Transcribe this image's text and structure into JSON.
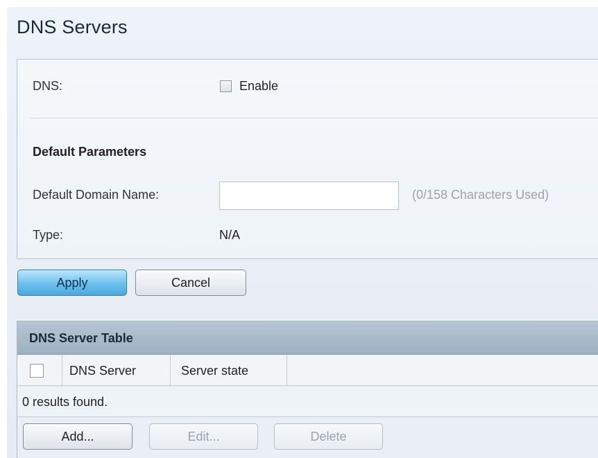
{
  "page": {
    "title": "DNS Servers"
  },
  "dns": {
    "label": "DNS:",
    "enable_label": "Enable",
    "enabled": false
  },
  "default_parameters": {
    "heading": "Default Parameters",
    "domain_name_label": "Default Domain Name:",
    "domain_name_value": "",
    "domain_name_hint": "(0/158 Characters Used)",
    "type_label": "Type:",
    "type_value": "N/A"
  },
  "form_actions": {
    "apply_label": "Apply",
    "cancel_label": "Cancel"
  },
  "dns_server_table": {
    "title": "DNS Server Table",
    "columns": [
      "DNS Server",
      "Server state"
    ],
    "results_text": "0 results found.",
    "add_label": "Add...",
    "edit_label": "Edit...",
    "delete_label": "Delete"
  },
  "colors": {
    "primary_button": "#49a9e0",
    "table_header": "#9fb0c0",
    "hint_text": "#9aa3ab"
  }
}
